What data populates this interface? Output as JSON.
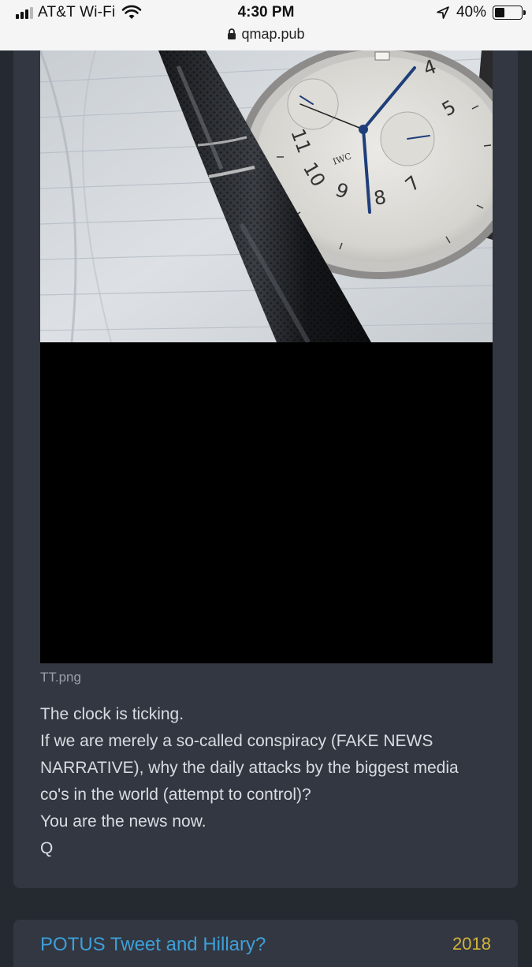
{
  "status_bar": {
    "carrier": "AT&T Wi-Fi",
    "time": "4:30 PM",
    "url": "qmap.pub",
    "battery_percent": "40%",
    "battery_level": 0.4,
    "signal_bars_active": 3,
    "signal_bars_total": 4,
    "icons": [
      "signal-icon",
      "wifi-icon",
      "lock-icon",
      "location-arrow-icon",
      "battery-icon"
    ]
  },
  "post": {
    "image_filename": "TT.png",
    "text_lines": [
      "The clock is ticking.",
      "If we are merely a so-called conspiracy (FAKE NEWS",
      "NARRATIVE), why the daily attacks by the biggest media",
      "co's in the world (attempt to control)?",
      "You are the news now.",
      "Q"
    ],
    "watch_brand": "IWC",
    "watch_numerals": [
      "4",
      "5",
      "7",
      "8",
      "9",
      "10",
      "11"
    ]
  },
  "next_post": {
    "title_partial": "POTUS Tweet and Hillary?",
    "date_partial": "2018"
  },
  "colors": {
    "background": "#252a31",
    "card": "#323741",
    "status_bar": "#f5f5f6",
    "text": "#d9dce1",
    "filename": "#9aa0a8",
    "link": "#3e9fd8",
    "date": "#d4b43a"
  }
}
